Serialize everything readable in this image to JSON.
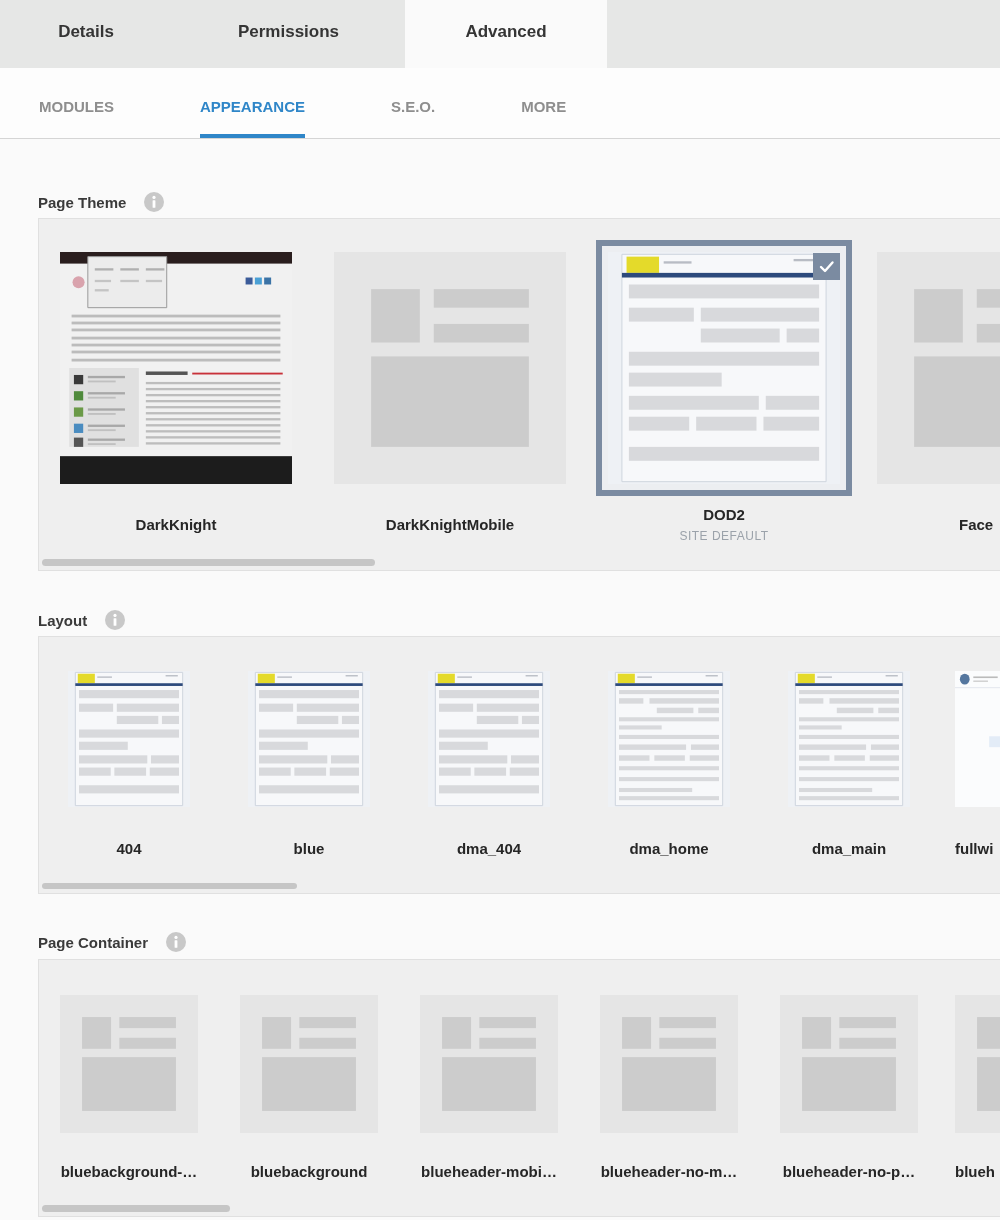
{
  "tabs": [
    {
      "label": "Details",
      "selected": false
    },
    {
      "label": "Permissions",
      "selected": false
    },
    {
      "label": "Advanced",
      "selected": true
    }
  ],
  "subtabs": [
    {
      "label": "MODULES",
      "selected": false
    },
    {
      "label": "APPEARANCE",
      "selected": true
    },
    {
      "label": "S.E.O.",
      "selected": false
    },
    {
      "label": "MORE",
      "selected": false
    }
  ],
  "page_theme": {
    "title": "Page Theme",
    "items": [
      {
        "name": "DarkKnight",
        "kind": "dark_page",
        "selected": false
      },
      {
        "name": "DarkKnightMobile",
        "kind": "placeholder",
        "selected": false
      },
      {
        "name": "DOD2",
        "kind": "blue_page",
        "selected": true,
        "note": "SITE DEFAULT"
      },
      {
        "name": "Face",
        "kind": "placeholder",
        "selected": false
      }
    ]
  },
  "layout": {
    "title": "Layout",
    "items": [
      {
        "name": "404",
        "kind": "blue_page"
      },
      {
        "name": "blue",
        "kind": "blue_page"
      },
      {
        "name": "dma_404",
        "kind": "blue_page"
      },
      {
        "name": "dma_home",
        "kind": "list_page"
      },
      {
        "name": "dma_main",
        "kind": "list_page"
      },
      {
        "name": "fullwi",
        "kind": "plain_page"
      }
    ]
  },
  "page_container": {
    "title": "Page Container",
    "items": [
      {
        "name": "bluebackground-…",
        "kind": "placeholder"
      },
      {
        "name": "bluebackground",
        "kind": "placeholder"
      },
      {
        "name": "blueheader-mobi…",
        "kind": "placeholder"
      },
      {
        "name": "blueheader-no-m…",
        "kind": "placeholder"
      },
      {
        "name": "blueheader-no-p…",
        "kind": "placeholder"
      },
      {
        "name": "blueh",
        "kind": "placeholder"
      }
    ]
  }
}
